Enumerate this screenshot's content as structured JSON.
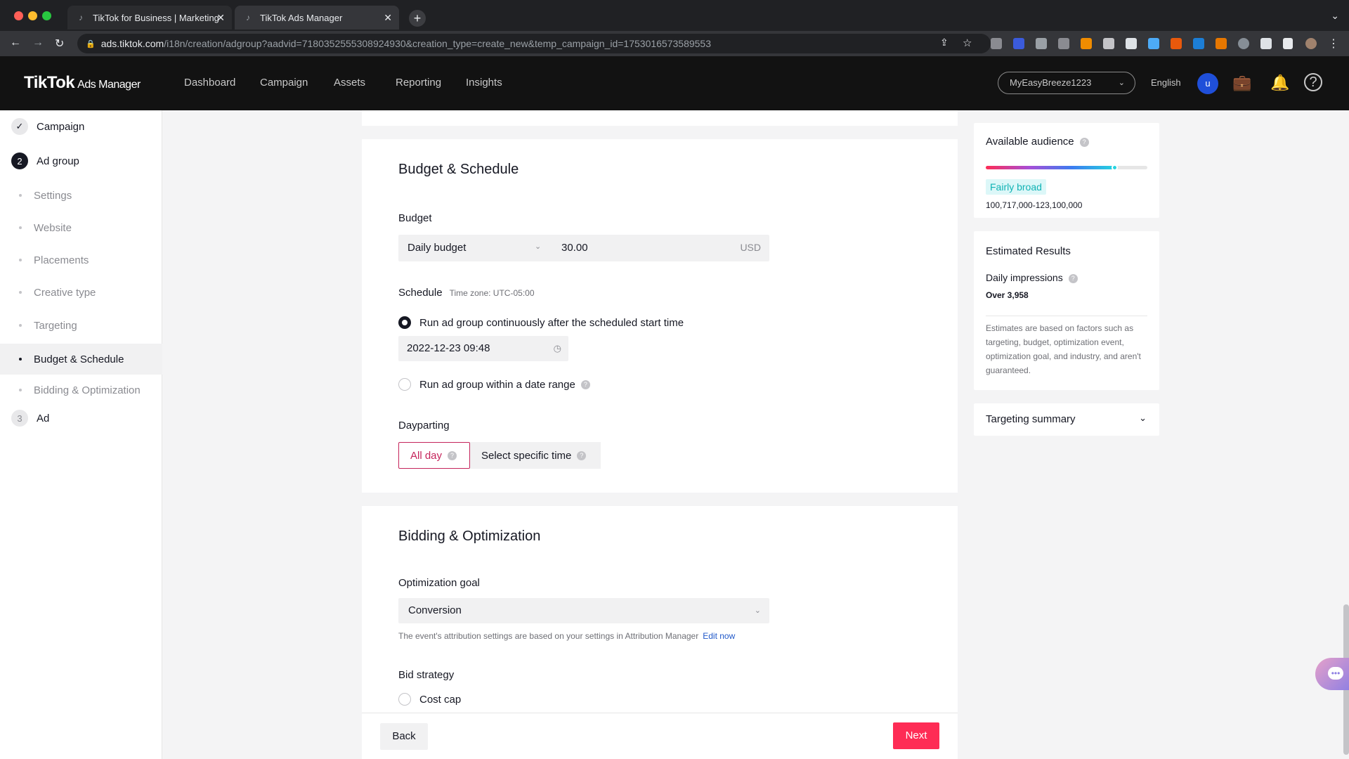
{
  "browser": {
    "tabs": [
      {
        "title": "TikTok for Business | Marketing",
        "active": false
      },
      {
        "title": "TikTok Ads Manager",
        "active": true
      }
    ],
    "url_host": "ads.tiktok.com",
    "url_path": "/i18n/creation/adgroup?aadvid=7180352555308924930&creation_type=create_new&temp_campaign_id=1753016573589553",
    "new_tab": "+"
  },
  "app": {
    "logo": "TikTok",
    "logo_sub": "Ads Manager",
    "nav": [
      "Dashboard",
      "Campaign",
      "Assets",
      "Reporting",
      "Insights"
    ],
    "account": "MyEasyBreeze1223",
    "language": "English",
    "user_initial": "u"
  },
  "sidebar": {
    "campaign": "Campaign",
    "adgroup_num": "2",
    "adgroup": "Ad group",
    "substeps": [
      "Settings",
      "Website",
      "Placements",
      "Creative type",
      "Targeting",
      "Budget & Schedule",
      "Bidding & Optimization"
    ],
    "active_substep": "Budget & Schedule",
    "ad_num": "3",
    "ad": "Ad"
  },
  "budget_schedule": {
    "title": "Budget & Schedule",
    "budget_label": "Budget",
    "budget_type": "Daily budget",
    "budget_value": "30.00",
    "currency": "USD",
    "schedule_label": "Schedule",
    "timezone": "Time zone: UTC-05:00",
    "option_continuous": "Run ad group continuously after the scheduled start time",
    "start_time": "2022-12-23 09:48",
    "option_range": "Run ad group within a date range",
    "dayparting_label": "Dayparting",
    "all_day": "All day",
    "specific_time": "Select specific time"
  },
  "bidding": {
    "title": "Bidding & Optimization",
    "goal_label": "Optimization goal",
    "goal_value": "Conversion",
    "hint": "The event's attribution settings are based on your settings in Attribution Manager",
    "edit_now": "Edit now",
    "strategy_label": "Bid strategy",
    "cost_cap": "Cost cap"
  },
  "footer": {
    "back": "Back",
    "next": "Next"
  },
  "audience": {
    "title": "Available audience",
    "level_fraction": 0.8,
    "breadth": "Fairly broad",
    "range": "100,717,000-123,100,000"
  },
  "estimates": {
    "title": "Estimated Results",
    "metric": "Daily impressions",
    "value": "Over 3,958",
    "note": "Estimates are based on factors such as targeting, budget, optimization event, optimization goal, and industry, and aren't guaranteed."
  },
  "targeting_summary": {
    "title": "Targeting summary"
  },
  "colors": {
    "accent": "#fe2c55",
    "selected_outline": "#c5245b",
    "link": "#2159c9",
    "broad_badge": "#10b3b5"
  }
}
